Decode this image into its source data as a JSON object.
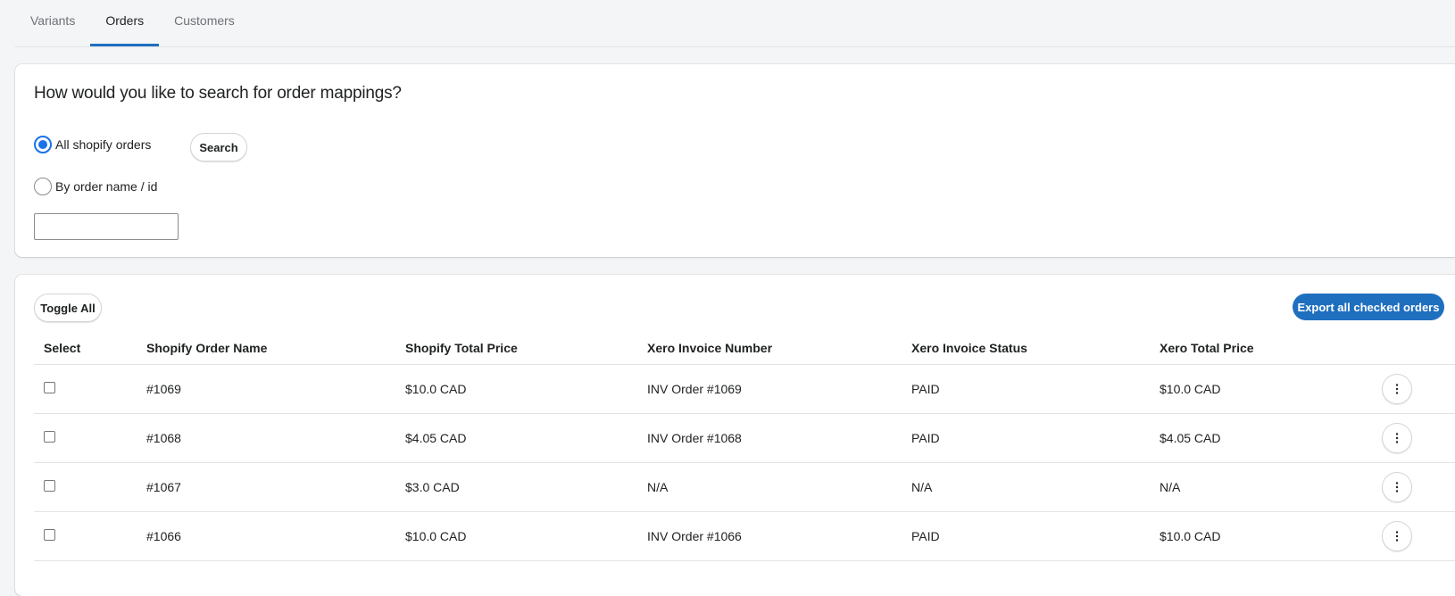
{
  "tabs": [
    {
      "label": "Variants",
      "active": false
    },
    {
      "label": "Orders",
      "active": true
    },
    {
      "label": "Customers",
      "active": false
    }
  ],
  "search": {
    "title": "How would you like to search for order mappings?",
    "options": [
      {
        "label": "All shopify orders",
        "selected": true
      },
      {
        "label": "By order name / id",
        "selected": false
      }
    ],
    "search_button": "Search",
    "input_value": "",
    "input_placeholder": ""
  },
  "orders_table": {
    "toggle_all_label": "Toggle All",
    "export_label": "Export all checked orders",
    "columns": [
      "Select",
      "Shopify Order Name",
      "Shopify Total Price",
      "Xero Invoice Number",
      "Xero Invoice Status",
      "Xero Total Price"
    ],
    "rows": [
      {
        "order_name": "#1069",
        "shopify_total": "$10.0 CAD",
        "invoice_number": "INV Order #1069",
        "invoice_status": "PAID",
        "xero_total": "$10.0 CAD",
        "checked": false
      },
      {
        "order_name": "#1068",
        "shopify_total": "$4.05 CAD",
        "invoice_number": "INV Order #1068",
        "invoice_status": "PAID",
        "xero_total": "$4.05 CAD",
        "checked": false
      },
      {
        "order_name": "#1067",
        "shopify_total": "$3.0 CAD",
        "invoice_number": "N/A",
        "invoice_status": "N/A",
        "xero_total": "N/A",
        "checked": false
      },
      {
        "order_name": "#1066",
        "shopify_total": "$10.0 CAD",
        "invoice_number": "INV Order #1066",
        "invoice_status": "PAID",
        "xero_total": "$10.0 CAD",
        "checked": false
      }
    ],
    "row_action_icon": "more-vertical-icon"
  },
  "colors": {
    "accent": "#1f6fbf",
    "radio_selected": "#1a73e8",
    "page_background": "#f4f5f7"
  }
}
